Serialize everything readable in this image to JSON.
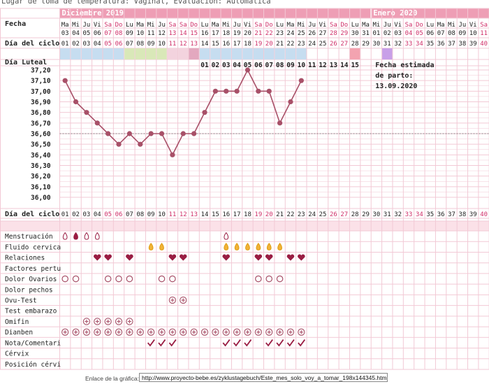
{
  "header": {
    "subtitle": "Lugar de toma de temperatura: Vaginal, Evaluación: Automática",
    "month1": "Diciembre 2019",
    "month2": "Enero 2020"
  },
  "row_labels": {
    "fecha": "Fecha",
    "dia_ciclo": "Día del ciclo",
    "dia_luteal": "Día Luteal",
    "dia_ciclo_bottom": "Día del ciclo"
  },
  "due_date": {
    "line1": "Fecha estimada",
    "line2": "de parto:",
    "line3": "13.09.2020"
  },
  "footer": {
    "label": "Enlace de la gráfica:",
    "url": "http://www.proyecto-bebe.es/zyklustagebuch/Este_mes_solo_voy_a_tomar_198x144345.htm"
  },
  "chart_data": {
    "type": "line",
    "title": "",
    "series": [
      {
        "values": [
          37.1,
          36.9,
          36.8,
          36.7,
          36.6,
          36.5,
          36.6,
          36.5,
          36.6,
          36.6,
          36.4,
          36.6,
          36.6,
          36.8,
          37.0,
          37.0,
          37.0,
          37.2,
          37.0,
          37.0,
          36.7,
          36.9,
          37.1
        ]
      }
    ],
    "coverline": 36.6,
    "ylim": [
      36.0,
      37.2
    ],
    "yticks": [
      "37,20",
      "37,10",
      "37,00",
      "36,90",
      "36,80",
      "36,70",
      "36,60",
      "36,50",
      "36,40",
      "36,30",
      "36,20",
      "36,10",
      "36,00"
    ],
    "days": [
      {
        "wd": "Ma",
        "d": "03",
        "c": "01",
        "w": false
      },
      {
        "wd": "Mi",
        "d": "04",
        "c": "02",
        "w": false
      },
      {
        "wd": "Ju",
        "d": "05",
        "c": "03",
        "w": false
      },
      {
        "wd": "Vi",
        "d": "06",
        "c": "04",
        "w": false
      },
      {
        "wd": "Sa",
        "d": "07",
        "c": "05",
        "w": true
      },
      {
        "wd": "Do",
        "d": "08",
        "c": "06",
        "w": true
      },
      {
        "wd": "Lu",
        "d": "09",
        "c": "07",
        "w": false
      },
      {
        "wd": "Ma",
        "d": "10",
        "c": "08",
        "w": false
      },
      {
        "wd": "Mi",
        "d": "11",
        "c": "09",
        "w": false
      },
      {
        "wd": "Ju",
        "d": "12",
        "c": "10",
        "w": false
      },
      {
        "wd": "Sa",
        "d": "13",
        "c": "11",
        "w": true
      },
      {
        "wd": "Sa",
        "d": "14",
        "c": "12",
        "w": true
      },
      {
        "wd": "Do",
        "d": "15",
        "c": "13",
        "w": true
      },
      {
        "wd": "Lu",
        "d": "16",
        "c": "14",
        "w": false
      },
      {
        "wd": "Ma",
        "d": "17",
        "c": "15",
        "w": false
      },
      {
        "wd": "Mi",
        "d": "18",
        "c": "16",
        "w": false
      },
      {
        "wd": "Ju",
        "d": "19",
        "c": "17",
        "w": false
      },
      {
        "wd": "Vi",
        "d": "20",
        "c": "18",
        "w": false
      },
      {
        "wd": "Sa",
        "d": "21",
        "c": "19",
        "w": true
      },
      {
        "wd": "Do",
        "d": "22",
        "c": "20",
        "w": true
      },
      {
        "wd": "Lu",
        "d": "23",
        "c": "21",
        "w": false
      },
      {
        "wd": "Ma",
        "d": "24",
        "c": "22",
        "w": false
      },
      {
        "wd": "Mi",
        "d": "25",
        "c": "23",
        "w": false
      },
      {
        "wd": "Ju",
        "d": "26",
        "c": "24",
        "w": false
      },
      {
        "wd": "Vi",
        "d": "27",
        "c": "25",
        "w": false
      },
      {
        "wd": "Sa",
        "d": "28",
        "c": "26",
        "w": true
      },
      {
        "wd": "Do",
        "d": "29",
        "c": "27",
        "w": true
      },
      {
        "wd": "Lu",
        "d": "30",
        "c": "28",
        "w": false
      },
      {
        "wd": "Ma",
        "d": "31",
        "c": "29",
        "w": false
      },
      {
        "wd": "Mi",
        "d": "01",
        "c": "30",
        "w": false
      },
      {
        "wd": "Ju",
        "d": "02",
        "c": "31",
        "w": false
      },
      {
        "wd": "Vi",
        "d": "03",
        "c": "32",
        "w": false
      },
      {
        "wd": "Sa",
        "d": "04",
        "c": "33",
        "w": true
      },
      {
        "wd": "Do",
        "d": "05",
        "c": "34",
        "w": true
      },
      {
        "wd": "Lu",
        "d": "06",
        "c": "35",
        "w": false
      },
      {
        "wd": "Ma",
        "d": "07",
        "c": "36",
        "w": false
      },
      {
        "wd": "Mi",
        "d": "08",
        "c": "37",
        "w": false
      },
      {
        "wd": "Ju",
        "d": "09",
        "c": "38",
        "w": false
      },
      {
        "wd": "Vi",
        "d": "10",
        "c": "39",
        "w": false
      },
      {
        "wd": "Sa",
        "d": "11",
        "c": "40",
        "w": true
      }
    ],
    "luteal": [
      "01",
      "02",
      "03",
      "04",
      "05",
      "06",
      "07",
      "08",
      "09",
      "10",
      "11",
      "12",
      "13",
      "14",
      "15"
    ],
    "luteal_start_index": 13,
    "bottom_cycle": [
      "01",
      "02",
      "03",
      "04",
      "05",
      "06",
      "07",
      "08",
      "09",
      "10",
      "11",
      "12",
      "13",
      "14",
      "15",
      "16",
      "17",
      "18",
      "19",
      "20",
      "21",
      "22",
      "23",
      "24",
      "25",
      "26",
      "27",
      "28",
      "29",
      "30",
      "31",
      "32",
      "33",
      "34",
      "35",
      "36",
      "37",
      "38",
      "39",
      "40"
    ],
    "band_colors": [
      "#c6ddf0",
      "#c6ddf0",
      "#c6ddf0",
      "#c6ddf0",
      "#c6ddf0",
      "#c6ddf0",
      "#d9e8b8",
      "#d9e8b8",
      "#d9e8b8",
      "#d9e8b8",
      "#f3d3de",
      "#f3d3de",
      "#e3a8bf",
      "#c6ddf0",
      "#c6ddf0",
      "#c6ddf0",
      "#c6ddf0",
      "#c6ddf0",
      "#c6ddf0",
      "#c6ddf0",
      "#c6ddf0",
      "#c6ddf0",
      "#c6ddf0",
      "",
      "",
      "",
      "",
      "#f3a3b0",
      "",
      "",
      "#c8a0e8",
      "",
      "",
      "",
      "",
      "",
      "",
      "",
      "",
      ""
    ],
    "symptom_rows": [
      {
        "label": "Menstruación",
        "marks": [
          [
            0,
            "drop-outline"
          ],
          [
            1,
            "drop-filled"
          ],
          [
            2,
            "drop-outline"
          ],
          [
            3,
            "drop-outline"
          ],
          [
            15,
            "drop-outline"
          ]
        ]
      },
      {
        "label": "Fluido cervica",
        "marks": [
          [
            8,
            "drop-yellow"
          ],
          [
            9,
            "drop-yellow"
          ],
          [
            15,
            "drop-yellow"
          ],
          [
            16,
            "drop-yellow"
          ],
          [
            17,
            "drop-yellow"
          ],
          [
            18,
            "drop-yellow"
          ],
          [
            19,
            "drop-yellow"
          ],
          [
            20,
            "drop-yellow"
          ]
        ]
      },
      {
        "label": "Relaciones",
        "marks": [
          [
            3,
            "heart"
          ],
          [
            4,
            "heart"
          ],
          [
            6,
            "heart"
          ],
          [
            10,
            "heart"
          ],
          [
            11,
            "heart"
          ],
          [
            15,
            "heart"
          ],
          [
            18,
            "heart"
          ],
          [
            19,
            "heart"
          ],
          [
            21,
            "heart"
          ],
          [
            22,
            "heart"
          ]
        ]
      },
      {
        "label": "Factores pertu",
        "marks": []
      },
      {
        "label": "Dolor Ovarios",
        "marks": [
          [
            0,
            "circle"
          ],
          [
            1,
            "circle"
          ],
          [
            4,
            "circle"
          ],
          [
            5,
            "circle"
          ],
          [
            6,
            "circle"
          ],
          [
            9,
            "circle"
          ],
          [
            10,
            "circle"
          ],
          [
            18,
            "circle"
          ],
          [
            19,
            "circle"
          ],
          [
            20,
            "circle"
          ]
        ]
      },
      {
        "label": "Dolor pechos",
        "marks": []
      },
      {
        "label": "Ovu-Test",
        "marks": [
          [
            10,
            "plus"
          ],
          [
            11,
            "plus"
          ]
        ]
      },
      {
        "label": "Test embarazo",
        "marks": []
      },
      {
        "label": "Omifin",
        "marks": [
          [
            2,
            "plus"
          ],
          [
            3,
            "plus"
          ],
          [
            4,
            "plus"
          ],
          [
            5,
            "plus"
          ],
          [
            6,
            "plus"
          ]
        ]
      },
      {
        "label": "Dianben",
        "marks": [
          [
            0,
            "plus"
          ],
          [
            1,
            "plus"
          ],
          [
            2,
            "plus"
          ],
          [
            3,
            "plus"
          ],
          [
            4,
            "plus"
          ],
          [
            5,
            "plus"
          ],
          [
            6,
            "plus"
          ],
          [
            7,
            "plus"
          ],
          [
            8,
            "plus"
          ],
          [
            9,
            "plus"
          ],
          [
            10,
            "plus"
          ],
          [
            11,
            "plus"
          ],
          [
            12,
            "plus"
          ],
          [
            13,
            "plus"
          ],
          [
            14,
            "plus"
          ],
          [
            15,
            "plus"
          ],
          [
            16,
            "plus"
          ],
          [
            17,
            "plus"
          ],
          [
            18,
            "plus"
          ],
          [
            19,
            "plus"
          ],
          [
            20,
            "plus"
          ],
          [
            21,
            "plus"
          ],
          [
            22,
            "plus"
          ]
        ]
      },
      {
        "label": "Nota/Comentari",
        "marks": [
          [
            8,
            "check"
          ],
          [
            9,
            "check"
          ],
          [
            10,
            "check"
          ],
          [
            15,
            "check"
          ],
          [
            16,
            "check"
          ],
          [
            17,
            "check"
          ],
          [
            19,
            "check"
          ],
          [
            20,
            "check"
          ],
          [
            21,
            "check"
          ],
          [
            22,
            "check"
          ]
        ]
      },
      {
        "label": "Cérvix",
        "marks": []
      },
      {
        "label": "Posición cérvi",
        "marks": []
      }
    ],
    "colors": {
      "grid": "#f2c9d5",
      "header_bg": "#ee9eb5",
      "pink_bg": "#fbe1e8",
      "line": "#a85068",
      "weekend": "#d0306a",
      "text": "#222222",
      "heart": "#9a1d43"
    }
  }
}
